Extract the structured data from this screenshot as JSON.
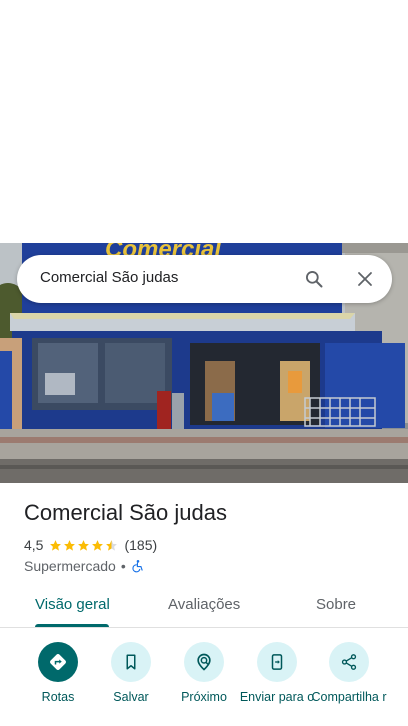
{
  "search": {
    "query": "Comercial São judas"
  },
  "storefront": {
    "sign_text": "Comercial"
  },
  "place": {
    "name": "Comercial São judas",
    "rating": "4,5",
    "rating_value": 4.5,
    "reviews_count": "(185)",
    "category": "Supermercado",
    "separator": "•"
  },
  "tabs": [
    {
      "label": "Visão geral",
      "active": true
    },
    {
      "label": "Avaliações",
      "active": false
    },
    {
      "label": "Sobre",
      "active": false
    }
  ],
  "actions": [
    {
      "label": "Rotas",
      "icon": "directions-icon"
    },
    {
      "label": "Salvar",
      "icon": "bookmark-icon"
    },
    {
      "label": "Próximo",
      "icon": "nearby-icon"
    },
    {
      "label": "Enviar para o",
      "icon": "send-to-phone-icon"
    },
    {
      "label": "Compartilha r",
      "icon": "share-icon"
    }
  ],
  "colors": {
    "accent": "#00696b",
    "star": "#fbbc04",
    "action_bg": "#d9f3f6",
    "building_blue": "#1f3f9a"
  }
}
